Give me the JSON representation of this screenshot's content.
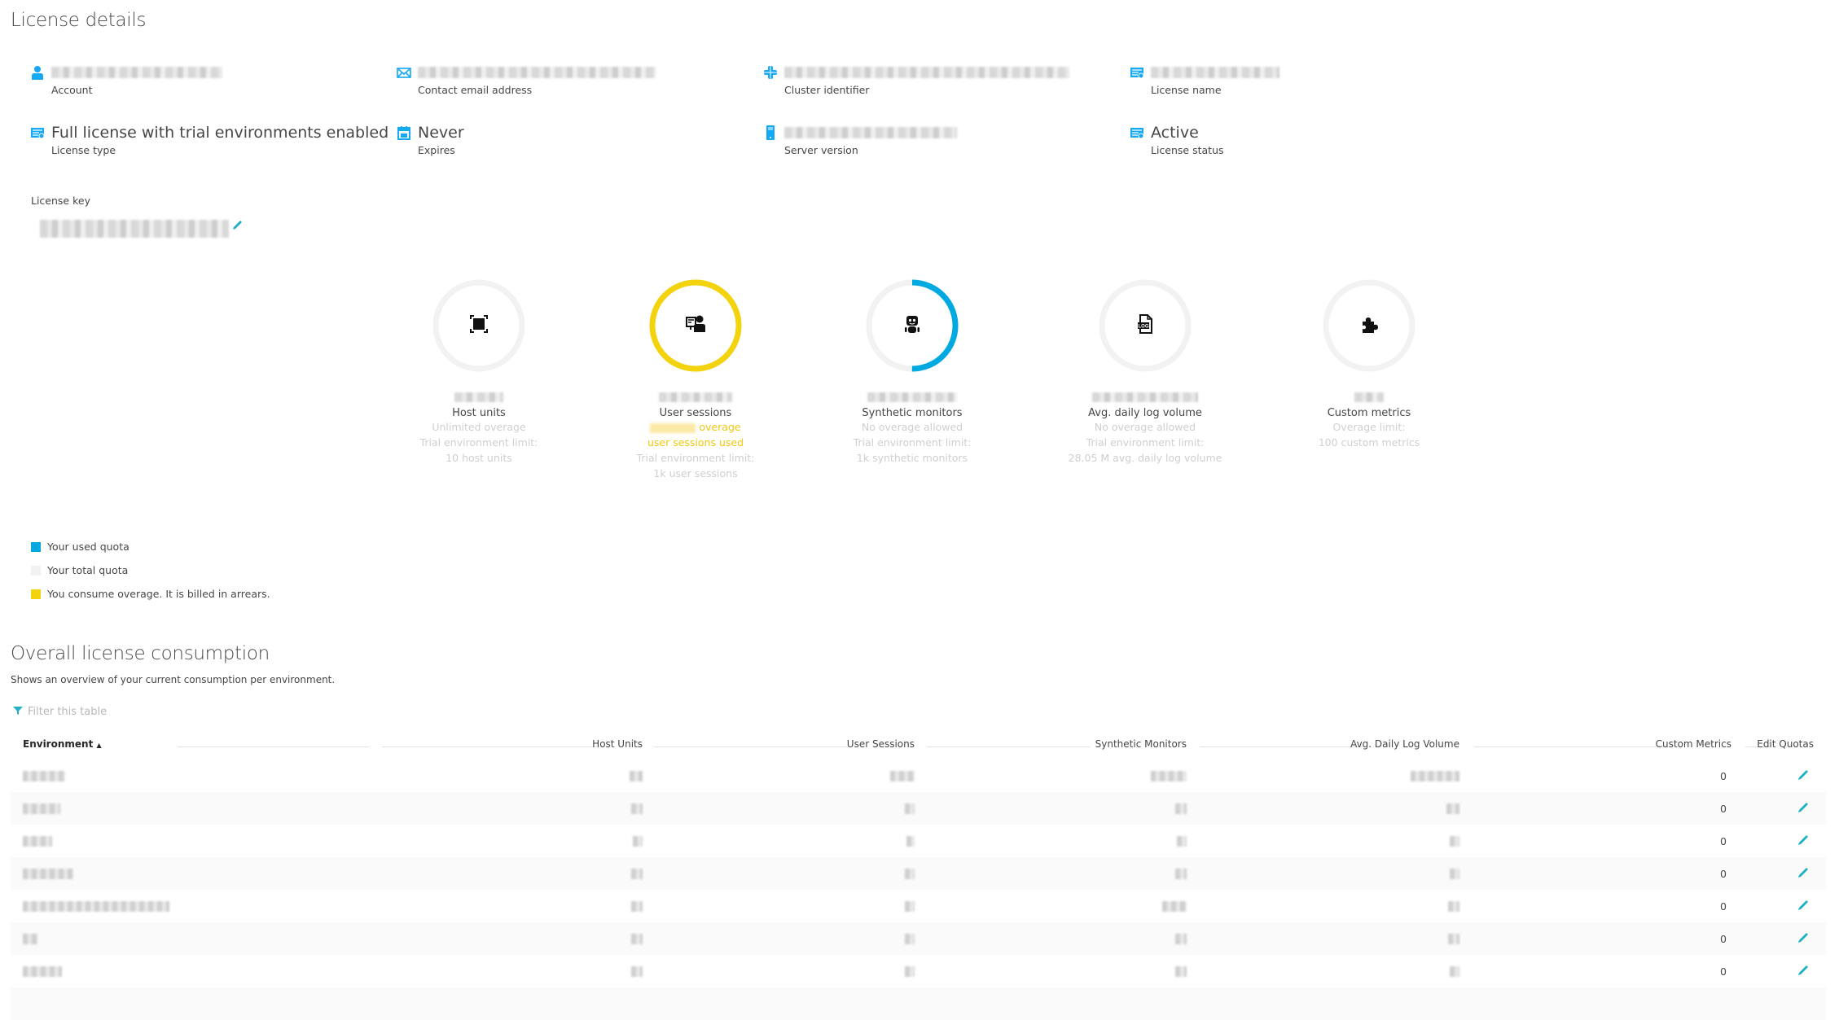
{
  "page_title": "License details",
  "details": [
    {
      "id": "account",
      "icon": "user-icon",
      "value": "",
      "value_redacted": true,
      "label": "Account"
    },
    {
      "id": "contact-email",
      "icon": "envelope-icon",
      "value": "",
      "value_redacted": true,
      "label": "Contact email address"
    },
    {
      "id": "cluster-id",
      "icon": "cluster-icon",
      "value": "",
      "value_redacted": true,
      "label": "Cluster identifier"
    },
    {
      "id": "license-name",
      "icon": "license-icon",
      "value": "",
      "value_redacted": true,
      "label": "License name"
    },
    {
      "id": "license-type",
      "icon": "license-icon",
      "value": "Full license with trial environments enabled",
      "value_redacted": false,
      "label": "License type"
    },
    {
      "id": "expires",
      "icon": "calendar-icon",
      "value": "Never",
      "value_redacted": false,
      "label": "Expires"
    },
    {
      "id": "server-version",
      "icon": "server-icon",
      "value": "",
      "value_redacted": true,
      "label": "Server version"
    },
    {
      "id": "license-status",
      "icon": "license-icon",
      "value": "Active",
      "value_redacted": false,
      "label": "License status"
    }
  ],
  "license_key": {
    "label": "License key",
    "value_redacted": true,
    "edit_icon": "pencil-icon"
  },
  "gauges": [
    {
      "id": "host-units",
      "icon": "host-icon",
      "title": "Host units",
      "state": "total",
      "used_fraction": 0,
      "lines": [
        "Unlimited overage",
        "Trial environment limit:",
        "10 host units"
      ]
    },
    {
      "id": "user-sessions",
      "icon": "user-session-icon",
      "title": "User sessions",
      "state": "overage",
      "used_fraction": 1,
      "warn_lines": [
        "overage",
        "user sessions used"
      ],
      "lines": [
        "Trial environment limit:",
        "1k user sessions"
      ]
    },
    {
      "id": "synthetic-monitors",
      "icon": "robot-icon",
      "title": "Synthetic monitors",
      "state": "used",
      "used_fraction": 0.5,
      "lines": [
        "No overage allowed",
        "Trial environment limit:",
        "1k synthetic monitors"
      ]
    },
    {
      "id": "log-volume",
      "icon": "log-file-icon",
      "title": "Avg. daily log volume",
      "state": "total",
      "used_fraction": 0,
      "lines": [
        "No overage allowed",
        "Trial environment limit:",
        "28.05 M avg. daily log volume"
      ]
    },
    {
      "id": "custom-metrics",
      "icon": "puzzle-icon",
      "title": "Custom metrics",
      "state": "total",
      "used_fraction": 0,
      "lines": [
        "Overage limit:",
        "100 custom metrics"
      ]
    }
  ],
  "colors": {
    "used": "#00a9e0",
    "total": "#f2f2f2",
    "overage": "#f3d20e",
    "accent": "#1fb0c3",
    "icon_blue": "#14a8f5"
  },
  "legend": [
    {
      "label": "Your used quota",
      "color_key": "used"
    },
    {
      "label": "Your total quota",
      "color_key": "total"
    },
    {
      "label": "You consume overage. It is billed in arrears.",
      "color_key": "overage"
    }
  ],
  "consumption": {
    "title": "Overall license consumption",
    "subtitle": "Shows an overview of your current consumption per environment.",
    "filter_placeholder": "Filter this table",
    "columns": [
      "Environment",
      "Host Units",
      "User Sessions",
      "Synthetic Monitors",
      "Avg. Daily Log Volume",
      "Custom Metrics",
      "Edit Quotas"
    ],
    "sort_indicator": "▲",
    "rows": [
      {
        "environment": "",
        "host_units": "",
        "user_sessions": "",
        "synthetic_monitors": "",
        "log_volume": "",
        "custom_metrics": "0",
        "redacted": true
      },
      {
        "environment": "",
        "host_units": "",
        "user_sessions": "",
        "synthetic_monitors": "",
        "log_volume": "",
        "custom_metrics": "0",
        "redacted": true
      },
      {
        "environment": "",
        "host_units": "",
        "user_sessions": "",
        "synthetic_monitors": "",
        "log_volume": "",
        "custom_metrics": "0",
        "redacted": true
      },
      {
        "environment": "",
        "host_units": "",
        "user_sessions": "",
        "synthetic_monitors": "",
        "log_volume": "",
        "custom_metrics": "0",
        "redacted": true
      },
      {
        "environment": "",
        "host_units": "",
        "user_sessions": "",
        "synthetic_monitors": "",
        "log_volume": "",
        "custom_metrics": "0",
        "redacted": true
      },
      {
        "environment": "",
        "host_units": "",
        "user_sessions": "",
        "synthetic_monitors": "",
        "log_volume": "",
        "custom_metrics": "0",
        "redacted": true
      },
      {
        "environment": "",
        "host_units": "",
        "user_sessions": "",
        "synthetic_monitors": "",
        "log_volume": "",
        "custom_metrics": "0",
        "redacted": true
      }
    ]
  }
}
